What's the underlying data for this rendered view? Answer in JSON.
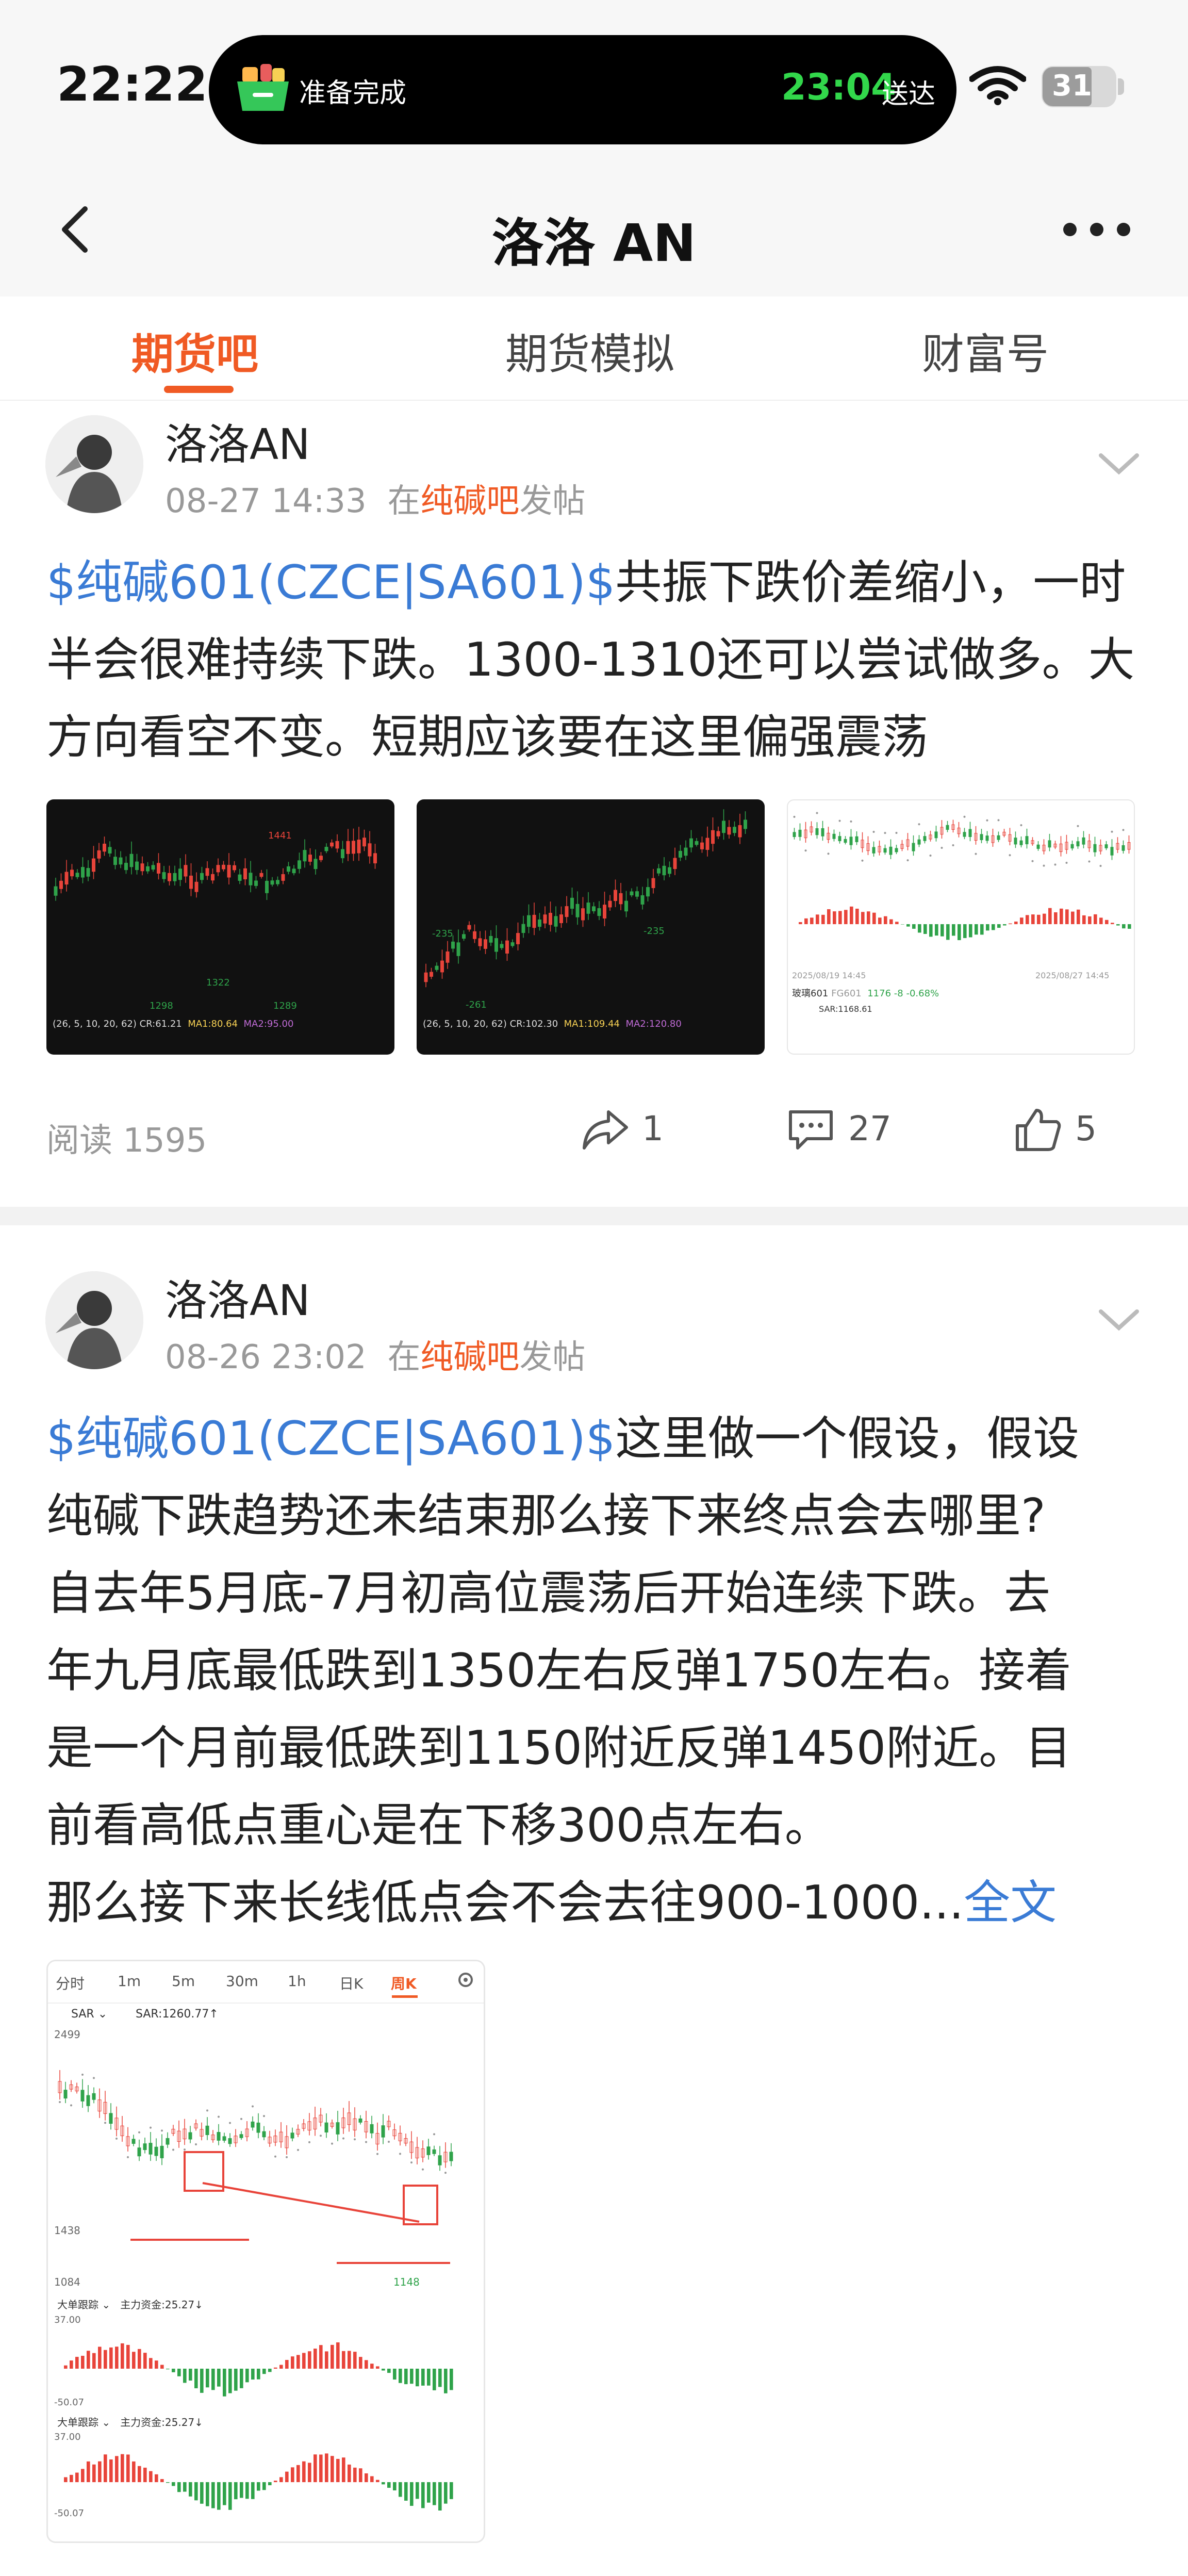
{
  "status": {
    "time": "22:22",
    "island_text": "准备完成",
    "island_time": "23:04",
    "island_suffix": "送达",
    "battery": "31"
  },
  "nav": {
    "title": "洛洛 AN"
  },
  "tabs": [
    {
      "label": "期货吧"
    },
    {
      "label": "期货模拟"
    },
    {
      "label": "财富号"
    }
  ],
  "posts": [
    {
      "author": "洛洛AN",
      "date": "08-27 14:33",
      "in": "在",
      "board": "纯碱吧",
      "posted": "发帖",
      "tag": "$纯碱601(CZCE|SA601)$",
      "text": "共振下跌价差缩小，一时半会很难持续下跌。1300-1310还可以尝试做多。大方向看空不变。短期应该要在这里偏强震荡",
      "reads": "阅读 1595",
      "shares": "1",
      "comments": "27",
      "likes": "5",
      "images": [
        "chart-1",
        "chart-2",
        "chart-3"
      ]
    },
    {
      "author": "洛洛AN",
      "date": "08-26 23:02",
      "in": "在",
      "board": "纯碱吧",
      "posted": "发帖",
      "tag": "$纯碱601(CZCE|SA601)$",
      "text_lines": [
        "这里做一个假设，假设",
        "纯碱下跌趋势还未结束那么接下来终点会去哪里?",
        "自去年5月底-7月初高位震荡后开始连续下跌。去",
        "年九月底最低跌到1350左右反弹1750左右。接着",
        "是一个月前最低跌到1150附近反弹1450附近。目",
        "前看高低点重心是在下移300点左右。"
      ],
      "last_line": "那么接下来长线低点会不会去往900-1000...",
      "more_label": "全文"
    }
  ],
  "chart_thumb_labels": {
    "c1": {
      "b1": "1441",
      "b2": "1298",
      "b3": "1322",
      "b4": "1289",
      "legend": "(26, 5, 10, 20, 62)  CR:61.21",
      "ma1": "MA1:80.64",
      "ma2": "MA2:95.00"
    },
    "c2": {
      "b1": "-235",
      "b2": "-235",
      "b3": "-261",
      "legend": "(26, 5, 10, 20, 62)  CR:102.30",
      "ma1": "MA1:109.44",
      "ma2": "MA2:120.80"
    },
    "c3": {
      "date1": "2025/08/19 14:45",
      "date2": "2025/08/27 14:45",
      "name": "玻璃601",
      "code": "FG601",
      "price": "1176",
      "chg": "-8",
      "pct": "-0.68%",
      "sar": "SAR:1168.61"
    }
  },
  "big_chart": {
    "tabs": [
      "分时",
      "1m",
      "5m",
      "30m",
      "1h",
      "日K",
      "周K"
    ],
    "active_tab": "周K",
    "sar_label": "SAR",
    "sar_value": "SAR:1260.77↑",
    "y_high": "2499",
    "y_mid": "1438",
    "y_low": "1084",
    "low_mark": "1148",
    "sub1_title": "大单跟踪",
    "sub1_value": "主力资金:25.27↓",
    "sub1_top": "37.00",
    "sub1_bottom": "-50.07",
    "sub2_title": "大单跟踪",
    "sub2_value": "主力资金:25.27↓",
    "sub2_top": "37.00",
    "sub2_bottom": "-50.07"
  },
  "colors": {
    "accent": "#f05a24",
    "link": "#3a7bd5",
    "up": "#e8443a",
    "down": "#2fa34a"
  }
}
